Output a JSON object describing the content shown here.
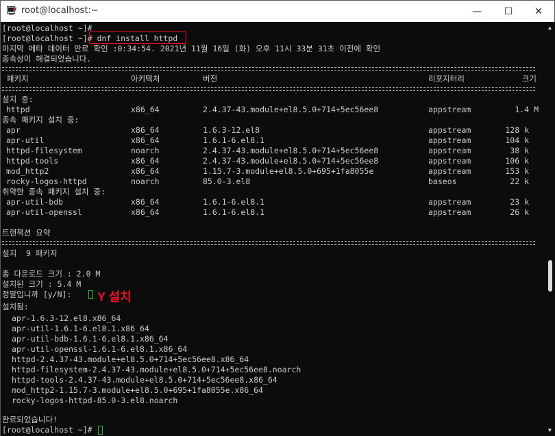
{
  "window": {
    "title": "root@localhost:~",
    "minimize_glyph": "—",
    "maximize_glyph": "☐",
    "close_glyph": "✕"
  },
  "prompt": {
    "text": "[root@localhost ~]#",
    "command": " dnf install httpd"
  },
  "metadata_line": "마지막 메타 데이터 만료 확인 :0:34:54. 2021년 11월 16일 (화) 오후 11시 33분 31초 이전에 확인",
  "resolved_line": "종속성이 해결되었습니다.",
  "table": {
    "headers": {
      "package": " 패키지",
      "arch": "아키텍처",
      "version": "버전",
      "repo": "리포지터리",
      "size": "크기"
    },
    "sections": [
      {
        "label": "설치 중:"
      },
      {
        "label": "종속 패키지 설치 중:"
      },
      {
        "label": "취약한 종속 패키지 설치 중:"
      }
    ],
    "installing": [
      {
        "package": "httpd",
        "arch": "x86_64",
        "version": "2.4.37-43.module+el8.5.0+714+5ec56ee8",
        "repo": "appstream",
        "size": "1.4 M"
      }
    ],
    "dependencies": [
      {
        "package": "apr",
        "arch": "x86_64",
        "version": "1.6.3-12.el8",
        "repo": "appstream",
        "size": "128 k"
      },
      {
        "package": "apr-util",
        "arch": "x86_64",
        "version": "1.6.1-6.el8.1",
        "repo": "appstream",
        "size": "104 k"
      },
      {
        "package": "httpd-filesystem",
        "arch": "noarch",
        "version": "2.4.37-43.module+el8.5.0+714+5ec56ee8",
        "repo": "appstream",
        "size": "38 k"
      },
      {
        "package": "httpd-tools",
        "arch": "x86_64",
        "version": "2.4.37-43.module+el8.5.0+714+5ec56ee8",
        "repo": "appstream",
        "size": "106 k"
      },
      {
        "package": "mod_http2",
        "arch": "x86_64",
        "version": "1.15.7-3.module+el8.5.0+695+1fa8055e",
        "repo": "appstream",
        "size": "153 k"
      },
      {
        "package": "rocky-logos-httpd",
        "arch": "noarch",
        "version": "85.0-3.el8",
        "repo": "baseos",
        "size": "22 k"
      }
    ],
    "weak_dependencies": [
      {
        "package": "apr-util-bdb",
        "arch": "x86_64",
        "version": "1.6.1-6.el8.1",
        "repo": "appstream",
        "size": "23 k"
      },
      {
        "package": "apr-util-openssl",
        "arch": "x86_64",
        "version": "1.6.1-6.el8.1",
        "repo": "appstream",
        "size": "26 k"
      }
    ]
  },
  "summary": {
    "title": "트랜잭션 요약",
    "install_count": "설치  9 패키지",
    "download_size": "총 다운로드 크기 : 2.0 M",
    "installed_size": "설치된 크기 : 5.4 M",
    "confirm": "정말입니까 [y/N]:"
  },
  "annotation": "Y 설치",
  "installed": {
    "title": "설치됨:",
    "items": [
      "apr-1.6.3-12.el8.x86_64",
      "apr-util-1.6.1-6.el8.1.x86_64",
      "apr-util-bdb-1.6.1-6.el8.1.x86_64",
      "apr-util-openssl-1.6.1-6.el8.1.x86_64",
      "httpd-2.4.37-43.module+el8.5.0+714+5ec56ee8.x86_64",
      "httpd-filesystem-2.4.37-43.module+el8.5.0+714+5ec56ee8.noarch",
      "httpd-tools-2.4.37-43.module+el8.5.0+714+5ec56ee8.x86_64",
      "mod_http2-1.15.7-3.module+el8.5.0+695+1fa8055e.x86_64",
      "rocky-logos-httpd-85.0-3.el8.noarch"
    ]
  },
  "complete": "완료되었습니다!",
  "colors": {
    "accent_red": "#e81123",
    "package_green": "#16c60c",
    "text": "#cccccc",
    "background": "#0c0c0c"
  },
  "icons": {
    "app": "putty-terminal-icon"
  }
}
